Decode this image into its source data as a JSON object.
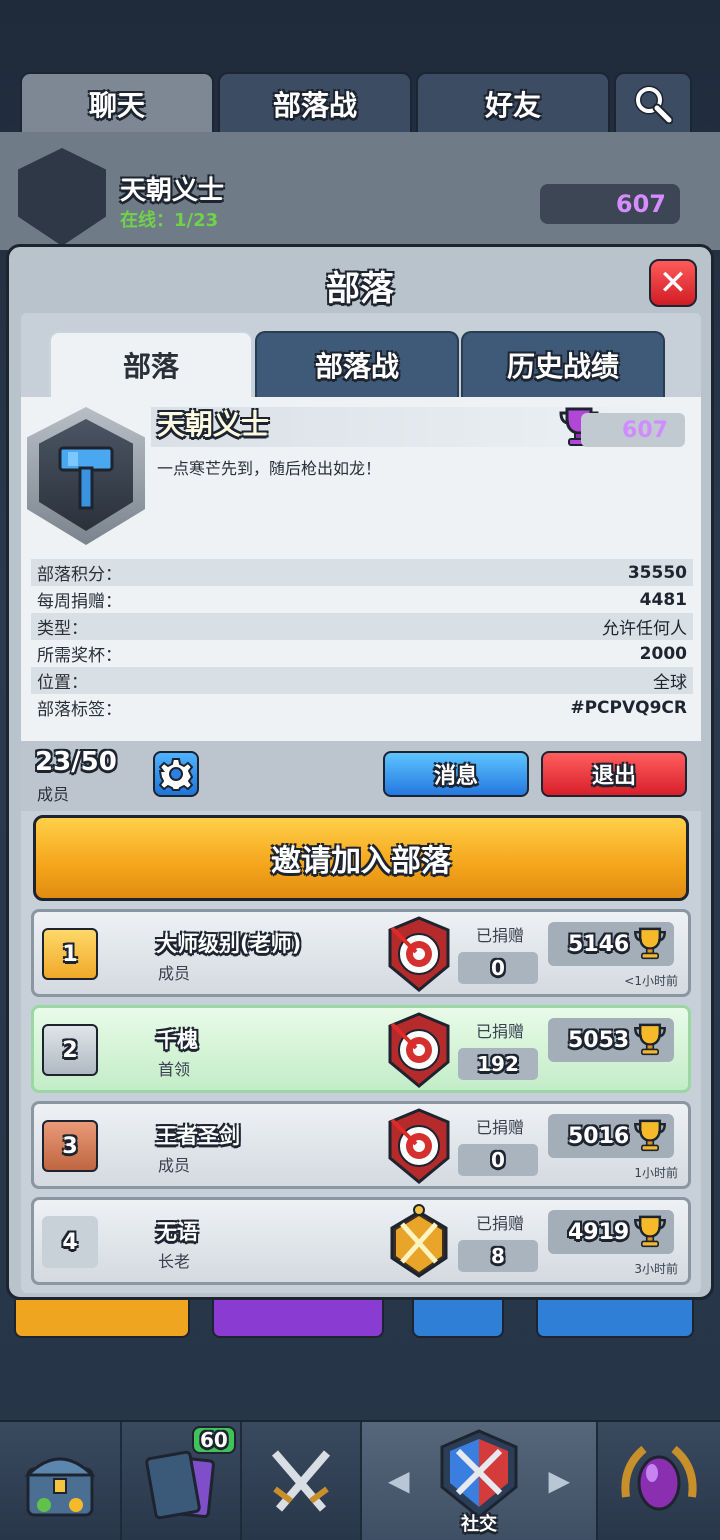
{
  "background": {
    "tabs": [
      "聊天",
      "部落战",
      "好友"
    ],
    "clan_name": "天朝义士",
    "online": "在线：1/23",
    "trophies": "607"
  },
  "modal": {
    "title": "部落",
    "close_label": "✕",
    "tabs": [
      "部落",
      "部落战",
      "历史战绩"
    ],
    "clan": {
      "name": "天朝义士",
      "trophies": "607",
      "description": "一点寒芒先到，随后枪出如龙！"
    },
    "stats": [
      {
        "label": "部落积分：",
        "value": "35550"
      },
      {
        "label": "每周捐赠：",
        "value": "4481"
      },
      {
        "label": "类型：",
        "value": "允许任何人"
      },
      {
        "label": "所需奖杯：",
        "value": "2000"
      },
      {
        "label": "位置：",
        "value": "全球"
      },
      {
        "label": "部落标签：",
        "value": "#PCPVQ9CR"
      }
    ],
    "member_count": "23/50",
    "member_count_label": "成员",
    "message_label": "消息",
    "exit_label": "退出",
    "invite_label": "邀请加入部落",
    "donated_label": "已捐赠",
    "members": [
      {
        "rank": "1",
        "name": "大师级别(老师)",
        "role": "成员",
        "donated": "0",
        "trophies": "5146",
        "last_seen": "<1小时前"
      },
      {
        "rank": "2",
        "name": "千槐",
        "role": "首领",
        "donated": "192",
        "trophies": "5053",
        "last_seen": ""
      },
      {
        "rank": "3",
        "name": "王者圣剑",
        "role": "成员",
        "donated": "0",
        "trophies": "5016",
        "last_seen": "1小时前"
      },
      {
        "rank": "4",
        "name": "无语",
        "role": "长老",
        "donated": "8",
        "trophies": "4919",
        "last_seen": "3小时前"
      }
    ]
  },
  "bottom_nav": {
    "cards_badge": "60",
    "social_label": "社交"
  },
  "colors": {
    "accent_yellow": "#f4a51a",
    "blue_button": "#2578e0",
    "red_button": "#d81f2a",
    "trophy_purple": "#d08cff"
  }
}
